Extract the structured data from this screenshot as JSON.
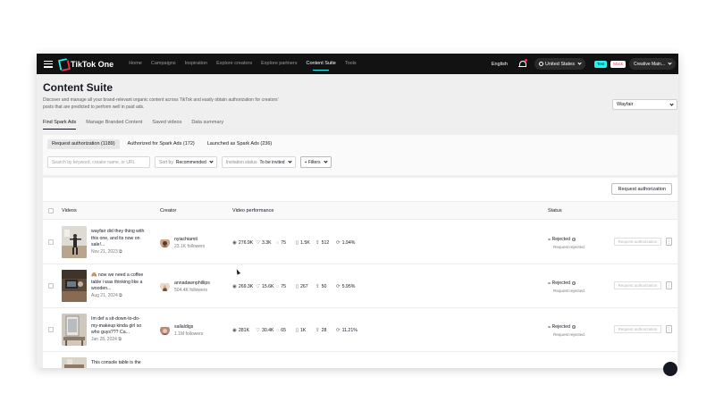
{
  "topnav": {
    "brand": "TikTok One",
    "items": [
      {
        "label": "Home"
      },
      {
        "label": "Campaigns"
      },
      {
        "label": "Inspiration"
      },
      {
        "label": "Explore creators"
      },
      {
        "label": "Explore partners"
      },
      {
        "label": "Content Suite",
        "active": true
      },
      {
        "label": "Tools"
      }
    ],
    "language": "English",
    "region": "United States",
    "test_label": "Test",
    "mock_label": "Mock",
    "account": "Creative Main..."
  },
  "header": {
    "title": "Content Suite",
    "description": "Discover and manage all your brand-relevant organic content across TikTok and easily obtain authorization for creators' posts that are predicted to perform well in paid ads.",
    "brand_select": "Wayfair"
  },
  "subtabs": [
    {
      "label": "Find Spark Ads",
      "active": true
    },
    {
      "label": "Manage Branded Content"
    },
    {
      "label": "Saved videos"
    },
    {
      "label": "Data summary"
    }
  ],
  "request_tabs": [
    {
      "label": "Request authorization (1189)",
      "active": true
    },
    {
      "label": "Authorized for Spark Ads (172)"
    },
    {
      "label": "Launched as Spark Ads (236)"
    }
  ],
  "filters": {
    "search_placeholder": "Search by keyword, creator name, or URL",
    "sort_label": "Sort by",
    "sort_value": "Recommended",
    "invite_label": "Invitation status",
    "invite_value": "To be invited",
    "filters_button": "+ Filters"
  },
  "table": {
    "request_button": "Request authorization",
    "columns": {
      "videos": "Videos",
      "creator": "Creator",
      "performance": "Video performance",
      "status": "Status"
    },
    "rows": [
      {
        "caption": "wayfair did they thing with this one, and its now on sale!...",
        "date": "Nov 21, 2023",
        "creator": "nyiachiamti",
        "followers": "23.1K followers",
        "views": "276.9K",
        "likes": "3.3K",
        "comments": "75",
        "saves": "1.5K",
        "shares": "512",
        "rate": "1.94%",
        "status": "Rejected",
        "status_sub": "Request rejected.",
        "action": "Request authorization"
      },
      {
        "caption": "🙈 now we need a coffee table i was thinking like a wooden...",
        "date": "Aug 21, 2024",
        "creator": "annadawnphillips",
        "followers": "504.4K followers",
        "views": "269.3K",
        "likes": "15.6K",
        "comments": "75",
        "saves": "267",
        "shares": "50",
        "rate": "5.95%",
        "status": "Rejected",
        "status_sub": "Request rejected.",
        "action": "Request authorization"
      },
      {
        "caption": "Im def a sit-down-to-do-my-makeup kinda girl so who guys??? Ca...",
        "date": "Jan 28, 2024",
        "creator": "sallaldigs",
        "followers": "1.1M followers",
        "views": "281K",
        "likes": "30.4K",
        "comments": "65",
        "saves": "1K",
        "shares": "28",
        "rate": "11.21%",
        "status": "Rejected",
        "status_sub": "Request rejected.",
        "action": "Request authorization"
      },
      {
        "caption": "This console table is the"
      }
    ]
  },
  "colors": {
    "topbar": "#121212",
    "accent_cyan": "#25f4ee",
    "accent_red": "#fe2c55"
  }
}
